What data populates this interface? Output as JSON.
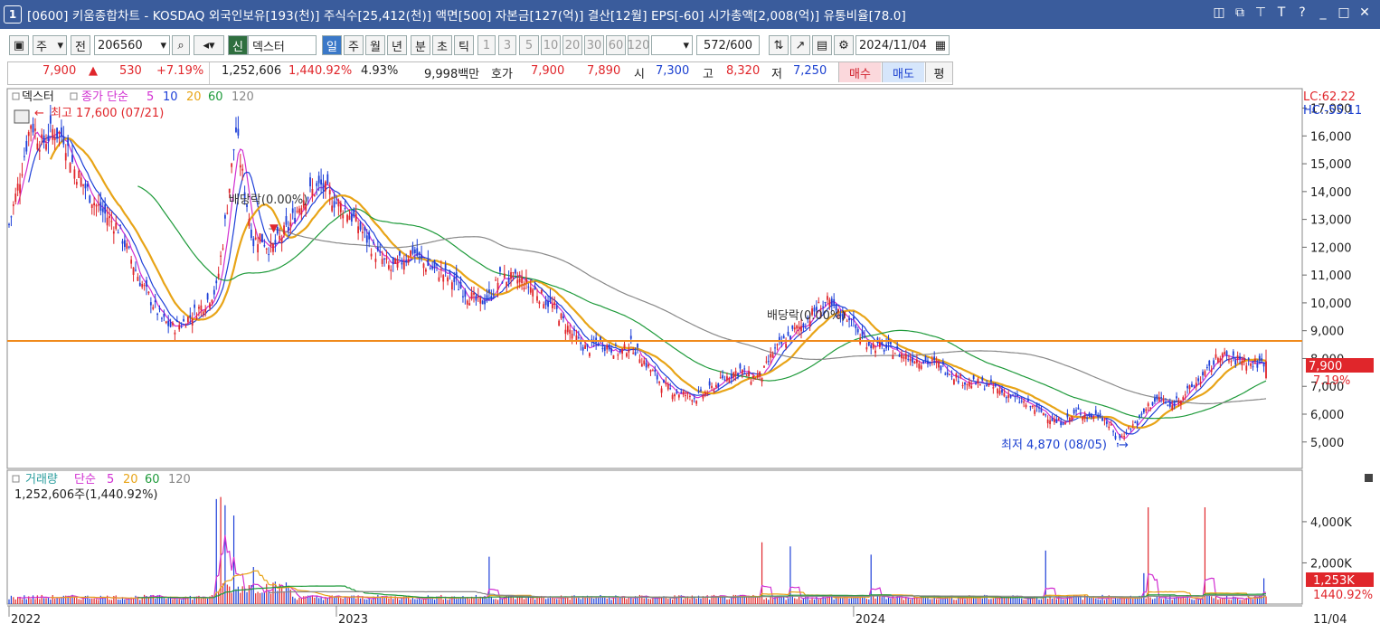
{
  "window": {
    "number": "1",
    "title": "[0600] 키움종합차트 - KOSDAQ 외국인보유[193(천)] 주식수[25,412(천)] 액면[500] 자본금[127(억)] 결산[12월] EPS[-60] 시가총액[2,008(억)] 유통비율[78.0]",
    "icons": [
      "split-icon",
      "restore-windows-icon",
      "pin-icon",
      "font-icon",
      "help-icon",
      "minimize-icon",
      "maximize-icon",
      "close-icon"
    ]
  },
  "toolbar": {
    "market_type": "주",
    "prev_label": "전",
    "stock_code": "206560",
    "stock_badge": "신",
    "stock_name": "덱스터",
    "periods": [
      "일",
      "주",
      "월",
      "년",
      "분",
      "초",
      "틱"
    ],
    "active_period": "일",
    "minute_options": [
      "1",
      "3",
      "5",
      "10",
      "20",
      "30",
      "60",
      "120"
    ],
    "count_value": "572",
    "count_max": "/600",
    "date": "2024/11/04"
  },
  "quote": {
    "price": "7,900",
    "arrow": "▲",
    "change": "530",
    "change_pct": "+7.19%",
    "volume": "1,252,606",
    "volume_ratio": "1,440.92%",
    "turnover": "4.93%",
    "amount": "9,998백만",
    "hoga_label": "호가",
    "ask": "7,900",
    "bid": "7,890",
    "open_label": "시",
    "open": "7,300",
    "high_label": "고",
    "high": "8,320",
    "low_label": "저",
    "low": "7,250",
    "buy_label": "매수",
    "sell_label": "매도",
    "eval_label": "평"
  },
  "price_pane": {
    "legend_name": "덱스터",
    "legend_ma": "종가 단순",
    "ma_periods": [
      "5",
      "10",
      "20",
      "60",
      "120"
    ],
    "ma_colors": [
      "#d12fd1",
      "#1d3fd8",
      "#e8a417",
      "#1e9a3a",
      "#888888"
    ],
    "hi_label": "최고 17,600 (07/21)",
    "lo_label": "최저 4,870 (08/05)",
    "lc_label": "LC:62.22",
    "hc_label": "HC:-55.11",
    "current_price": "7,900",
    "current_pct": "7.19%",
    "dividend_labels": [
      "배당락(0.00%)",
      "배당락(0.00%)"
    ],
    "hline_color": "#f08a1c"
  },
  "volume_pane": {
    "legend_name": "거래량",
    "legend_ma": "단순",
    "ma_periods": [
      "5",
      "20",
      "60",
      "120"
    ],
    "current_text": "1,252,606주(1,440.92%)",
    "current_value": "1,253K",
    "current_pct": "1440.92%"
  },
  "x_axis": {
    "labels": [
      "2022",
      "2023",
      "2024",
      "11/04"
    ]
  },
  "chart_data": {
    "type": "candlestick",
    "title": "덱스터 일봉",
    "price_axis": {
      "ticks": [
        5000,
        6000,
        7000,
        8000,
        9000,
        10000,
        11000,
        12000,
        13000,
        14000,
        15000,
        16000,
        17000
      ],
      "ticklabels": [
        "5,000",
        "6,000",
        "7,000",
        "8,000",
        "9,000",
        "10,000",
        "11,000",
        "12,000",
        "13,000",
        "14,000",
        "15,000",
        "16,000",
        "17,000"
      ],
      "ylim": [
        4050,
        17700
      ]
    },
    "volume_axis": {
      "ticks": [
        2000,
        4000
      ],
      "ticklabels": [
        "2,000K",
        "4,000K"
      ],
      "ylim": [
        0,
        6500
      ]
    },
    "xlim": [
      0,
      576
    ],
    "year_ticks": [
      {
        "label": "2022",
        "x": 0
      },
      {
        "label": "2023",
        "x": 150
      },
      {
        "label": "2024",
        "x": 387
      },
      {
        "label": "11/04",
        "x": 576
      }
    ],
    "close_anchors": [
      [
        0,
        12800
      ],
      [
        5,
        14500
      ],
      [
        10,
        16500
      ],
      [
        15,
        15700
      ],
      [
        20,
        16200
      ],
      [
        25,
        16000
      ],
      [
        30,
        14800
      ],
      [
        40,
        13500
      ],
      [
        50,
        12700
      ],
      [
        60,
        10800
      ],
      [
        70,
        9400
      ],
      [
        75,
        9100
      ],
      [
        80,
        9300
      ],
      [
        90,
        10000
      ],
      [
        95,
        10500
      ],
      [
        98,
        12200
      ],
      [
        100,
        13500
      ],
      [
        104,
        16200
      ],
      [
        108,
        14000
      ],
      [
        112,
        12200
      ],
      [
        115,
        12400
      ],
      [
        120,
        11900
      ],
      [
        128,
        12700
      ],
      [
        135,
        13800
      ],
      [
        143,
        14200
      ],
      [
        150,
        13600
      ],
      [
        155,
        13300
      ],
      [
        160,
        12800
      ],
      [
        168,
        11800
      ],
      [
        175,
        11200
      ],
      [
        180,
        11500
      ],
      [
        185,
        11900
      ],
      [
        190,
        11400
      ],
      [
        200,
        11000
      ],
      [
        205,
        10700
      ],
      [
        210,
        10300
      ],
      [
        215,
        10000
      ],
      [
        220,
        10200
      ],
      [
        225,
        10900
      ],
      [
        235,
        10800
      ],
      [
        240,
        10500
      ],
      [
        250,
        9800
      ],
      [
        255,
        9200
      ],
      [
        260,
        8700
      ],
      [
        265,
        8300
      ],
      [
        270,
        8600
      ],
      [
        275,
        8400
      ],
      [
        280,
        8200
      ],
      [
        285,
        8500
      ],
      [
        290,
        8000
      ],
      [
        295,
        7500
      ],
      [
        300,
        7000
      ],
      [
        305,
        6800
      ],
      [
        310,
        6700
      ],
      [
        315,
        6600
      ],
      [
        320,
        6800
      ],
      [
        325,
        7100
      ],
      [
        330,
        7400
      ],
      [
        335,
        7600
      ],
      [
        340,
        7300
      ],
      [
        345,
        7400
      ],
      [
        350,
        8200
      ],
      [
        355,
        8600
      ],
      [
        360,
        9000
      ],
      [
        365,
        9300
      ],
      [
        370,
        9800
      ],
      [
        375,
        10000
      ],
      [
        380,
        9600
      ],
      [
        385,
        9500
      ],
      [
        390,
        8800
      ],
      [
        395,
        8500
      ],
      [
        400,
        8400
      ],
      [
        405,
        8300
      ],
      [
        410,
        8100
      ],
      [
        415,
        8000
      ],
      [
        420,
        7900
      ],
      [
        425,
        7800
      ],
      [
        430,
        7600
      ],
      [
        435,
        7300
      ],
      [
        440,
        7100
      ],
      [
        445,
        7100
      ],
      [
        450,
        7000
      ],
      [
        455,
        6800
      ],
      [
        460,
        6600
      ],
      [
        465,
        6400
      ],
      [
        470,
        6200
      ],
      [
        475,
        6000
      ],
      [
        480,
        5700
      ],
      [
        485,
        5800
      ],
      [
        490,
        6100
      ],
      [
        495,
        5900
      ],
      [
        500,
        6000
      ],
      [
        505,
        5500
      ],
      [
        508,
        5000
      ],
      [
        512,
        5400
      ],
      [
        518,
        5800
      ],
      [
        522,
        6300
      ],
      [
        528,
        6600
      ],
      [
        532,
        6200
      ],
      [
        536,
        6600
      ],
      [
        540,
        6800
      ],
      [
        545,
        7200
      ],
      [
        550,
        7600
      ],
      [
        555,
        8200
      ],
      [
        560,
        7900
      ],
      [
        565,
        8000
      ],
      [
        570,
        7800
      ],
      [
        576,
        7900
      ]
    ],
    "moving_averages": [
      "MA5",
      "MA10",
      "MA20",
      "MA60",
      "MA120"
    ],
    "volume_spikes_k": [
      [
        95,
        5100
      ],
      [
        97,
        5200
      ],
      [
        99,
        4800
      ],
      [
        103,
        4300
      ],
      [
        112,
        1800
      ],
      [
        220,
        2300
      ],
      [
        345,
        3000
      ],
      [
        358,
        2800
      ],
      [
        395,
        2400
      ],
      [
        475,
        2600
      ],
      [
        520,
        1500
      ],
      [
        522,
        4700
      ],
      [
        548,
        4700
      ],
      [
        575,
        1253
      ]
    ]
  }
}
